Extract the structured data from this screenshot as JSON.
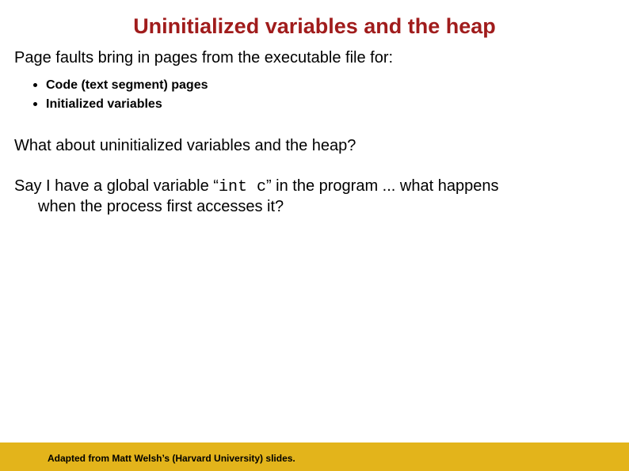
{
  "title": "Uninitialized variables and the heap",
  "p1": "Page faults bring in pages from the executable file for:",
  "bullets": [
    "Code (text segment) pages",
    "Initialized variables"
  ],
  "p2": "What about uninitialized variables and the heap?",
  "p3_pre": "Say I have a global variable “",
  "p3_code": "int c",
  "p3_post": "” in the program ... what happens",
  "p3_line2": "when the process first accesses it?",
  "footer": "Adapted from Matt Welsh’s (Harvard University) slides."
}
